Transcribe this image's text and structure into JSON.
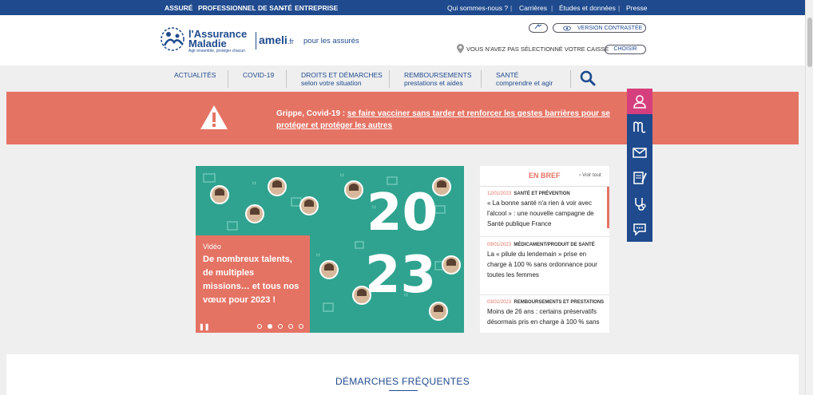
{
  "topbar": {
    "left": [
      "ASSURÉ",
      "PROFESSIONNEL DE SANTÉ",
      "ENTREPRISE"
    ],
    "right": [
      "Qui sommes-nous ?",
      "Carrières",
      "Études et données",
      "Presse"
    ]
  },
  "header": {
    "logo_line1": "l'Assurance",
    "logo_line2": "Maladie",
    "logo_tagline": "Agir ensemble, protéger chacun",
    "ameli": "ameli",
    "ameli_suffix": ".fr",
    "audience": "pour les assurés",
    "contrast": "VERSION CONTRASTÉE",
    "caisse_text": "VOUS N'AVEZ PAS SÉLECTIONNÉ VOTRE CAISSE",
    "choose": "CHOISIR"
  },
  "nav": {
    "items": [
      {
        "title": "ACTUALITÉS",
        "sub": ""
      },
      {
        "title": "COVID-19",
        "sub": ""
      },
      {
        "title": "DROITS ET DÉMARCHES",
        "sub": "selon votre situation"
      },
      {
        "title": "REMBOURSEMENTS",
        "sub": "prestations et aides"
      },
      {
        "title": "SANTÉ",
        "sub": "comprendre et agir"
      }
    ]
  },
  "alert": {
    "prefix": "Grippe, Covid-19 : ",
    "link": "se faire vacciner sans tarder et renforcer les gestes barrières pour se protéger et protéger les autres"
  },
  "slider": {
    "kind": "Vidéo",
    "title": "De nombreux talents, de multiples missions… et tous nos vœux pour 2023 !",
    "year_top": "20",
    "year_bottom": "23",
    "slides": 5,
    "active_slide": 2
  },
  "brief": {
    "title": "EN BREF",
    "see_all": "Voir tout",
    "items": [
      {
        "date": "12/01/2023",
        "category": "SANTÉ ET PRÉVENTION",
        "text": "« La bonne santé n'a rien à voir avec l'alcool » : une nouvelle campagne de Santé publique France"
      },
      {
        "date": "09/01/2023",
        "category": "MÉDICAMENT/PRODUIT DE SANTÉ",
        "text": "La « pilule du lendemain » prise en charge à 100 % sans ordonnance pour toutes les femmes"
      },
      {
        "date": "03/01/2023",
        "category": "REMBOURSEMENTS ET PRESTATIONS",
        "text": "Moins de 26 ans : certains préservatifs désormais pris en charge à 100 % sans"
      }
    ]
  },
  "frequent": {
    "title": "DÉMARCHES FRÉQUENTES"
  },
  "colors": {
    "brand_blue": "#1f4a8e",
    "alert_coral": "#e57364",
    "slider_teal": "#2fa38f",
    "account_pink": "#d63f7e"
  },
  "side_tools": [
    "account-icon",
    "ameli-m-icon",
    "mail-icon",
    "form-icon",
    "stethoscope-icon",
    "chat-icon"
  ]
}
